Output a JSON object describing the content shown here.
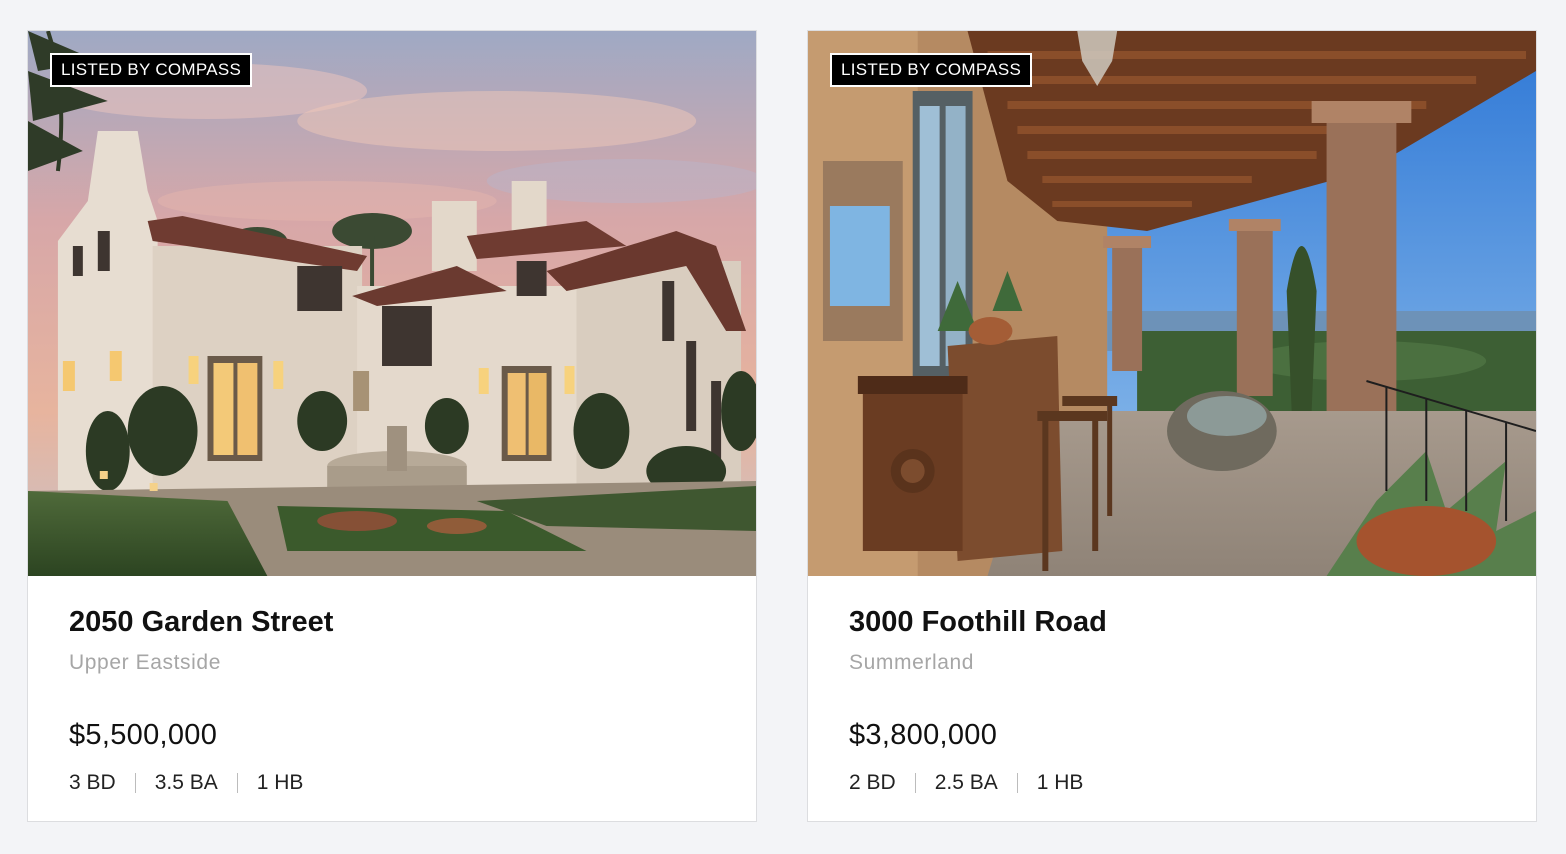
{
  "listings": [
    {
      "badge": "LISTED BY COMPASS",
      "address": "2050 Garden Street",
      "neighborhood": "Upper Eastside",
      "price": "$5,500,000",
      "beds": "3 BD",
      "baths": "3.5 BA",
      "half_baths": "1 HB"
    },
    {
      "badge": "LISTED BY COMPASS",
      "address": "3000 Foothill Road",
      "neighborhood": "Summerland",
      "price": "$3,800,000",
      "beds": "2 BD",
      "baths": "2.5 BA",
      "half_baths": "1 HB"
    }
  ],
  "colors": {
    "background": "#f3f4f7",
    "badge_bg": "#000000",
    "neighborhood_text": "#a6a6a6"
  }
}
